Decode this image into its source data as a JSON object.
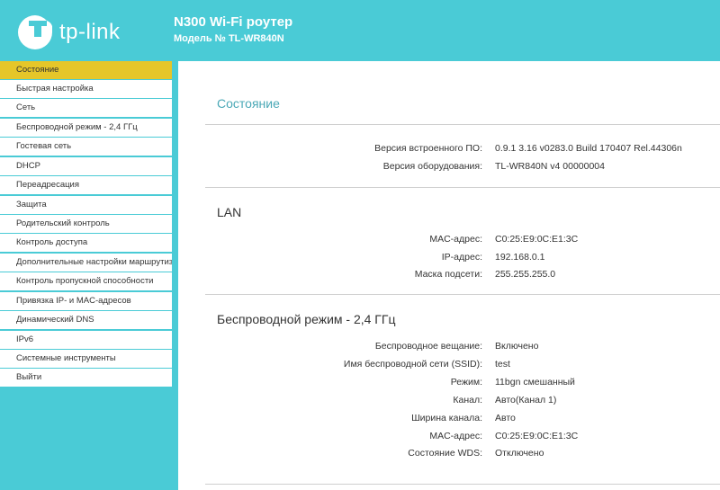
{
  "header": {
    "logo_text": "tp-link",
    "model_title": "N300 Wi-Fi роутер",
    "model_sub": "Модель № TL-WR840N"
  },
  "sidebar": {
    "items": [
      {
        "label": "Состояние"
      },
      {
        "label": "Быстрая настройка"
      },
      {
        "label": "Сеть"
      },
      {
        "label": "Беспроводной режим - 2,4 ГГц"
      },
      {
        "label": "Гостевая сеть"
      },
      {
        "label": "DHCP"
      },
      {
        "label": "Переадресация"
      },
      {
        "label": "Защита"
      },
      {
        "label": "Родительский контроль"
      },
      {
        "label": "Контроль доступа"
      },
      {
        "label": "Дополнительные настройки маршрутизатора"
      },
      {
        "label": "Контроль пропускной способности"
      },
      {
        "label": "Привязка IP- и MAC-адресов"
      },
      {
        "label": "Динамический DNS"
      },
      {
        "label": "IPv6"
      },
      {
        "label": "Системные инструменты"
      },
      {
        "label": "Выйти"
      }
    ]
  },
  "main": {
    "status_title": "Состояние",
    "firmware": {
      "rows": [
        {
          "label": "Версия встроенного ПО:",
          "value": "0.9.1 3.16 v0283.0 Build 170407 Rel.44306n"
        },
        {
          "label": "Версия оборудования:",
          "value": "TL-WR840N v4 00000004"
        }
      ]
    },
    "lan": {
      "title": "LAN",
      "rows": [
        {
          "label": "MAC-адрес:",
          "value": "C0:25:E9:0C:E1:3C"
        },
        {
          "label": "IP-адрес:",
          "value": "192.168.0.1"
        },
        {
          "label": "Маска подсети:",
          "value": "255.255.255.0"
        }
      ]
    },
    "wireless": {
      "title": "Беспроводной режим - 2,4 ГГц",
      "rows": [
        {
          "label": "Беспроводное вещание:",
          "value": "Включено"
        },
        {
          "label": "Имя беспроводной сети (SSID):",
          "value": "test"
        },
        {
          "label": "Режим:",
          "value": "11bgn смешанный"
        },
        {
          "label": "Канал:",
          "value": "Авто(Канал 1)"
        },
        {
          "label": "Ширина канала:",
          "value": "Авто"
        },
        {
          "label": "MAC-адрес:",
          "value": "C0:25:E9:0C:E1:3C"
        },
        {
          "label": "Состояние WDS:",
          "value": "Отключено"
        }
      ]
    }
  },
  "colors": {
    "brand": "#4acbd6",
    "active_menu": "#e5c629",
    "status_title": "#4aa8b6"
  }
}
